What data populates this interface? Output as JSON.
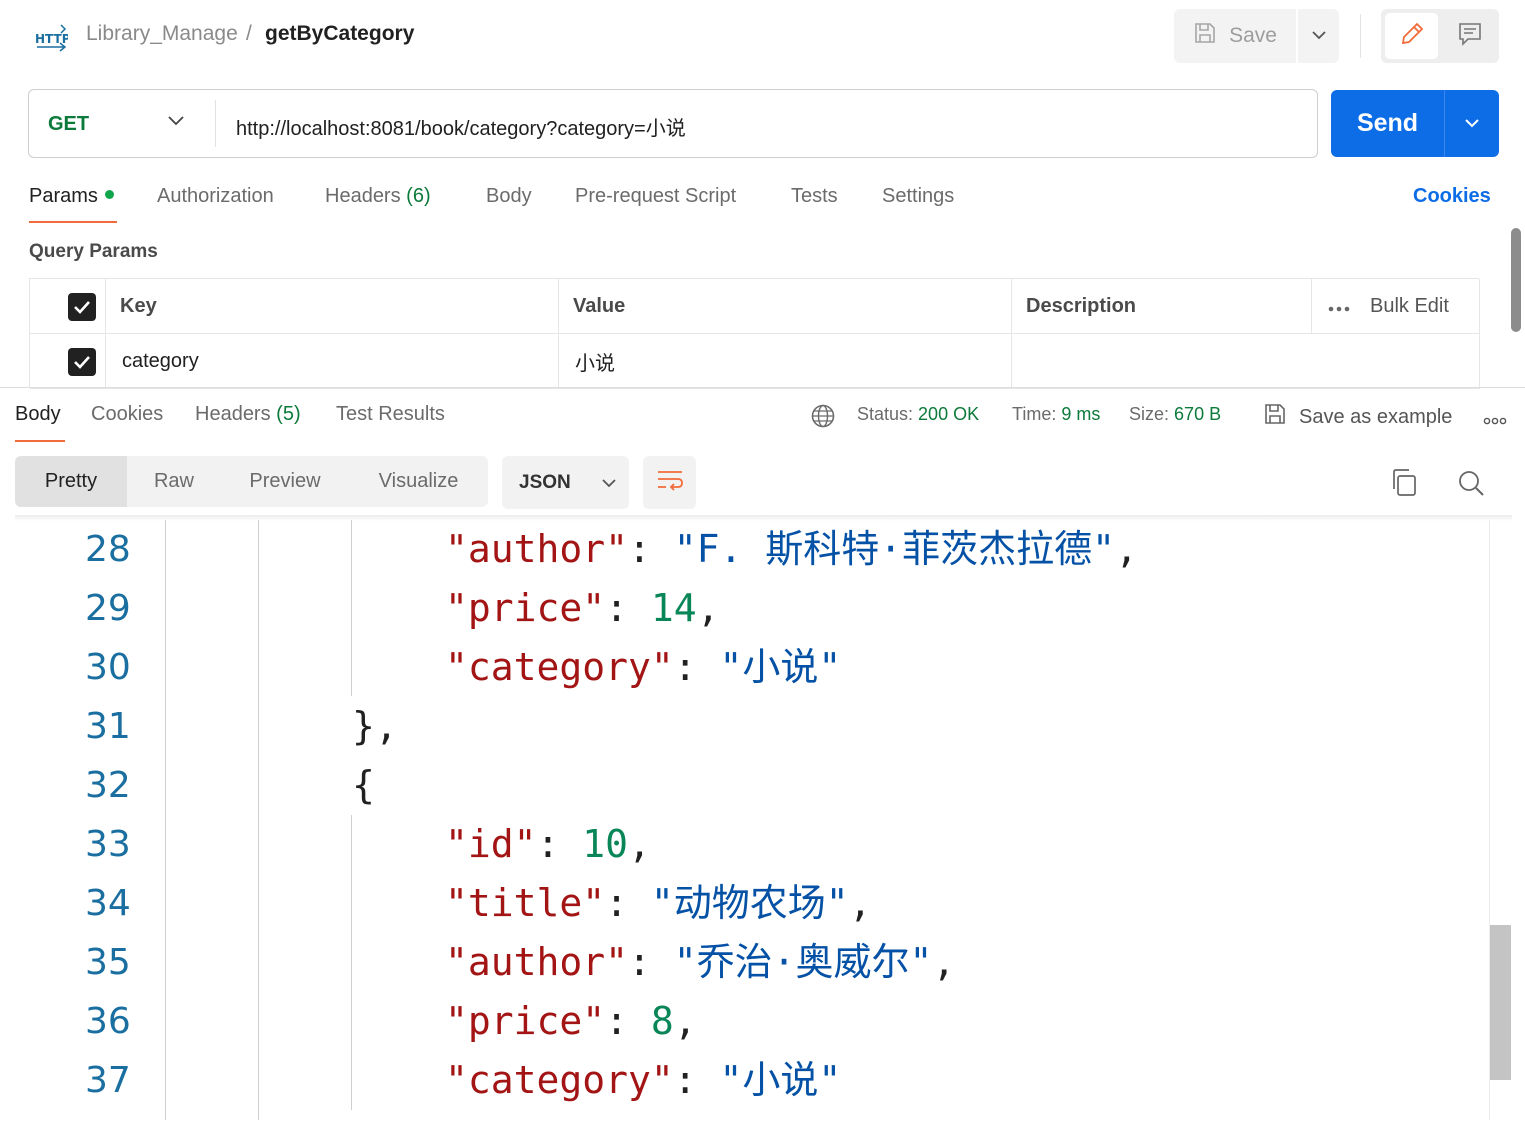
{
  "header": {
    "collection": "Library_Manage",
    "separator": "/",
    "request_name": "getByCategory",
    "save_label": "Save"
  },
  "request": {
    "method": "GET",
    "url": "http://localhost:8081/book/category?category=小说",
    "send_label": "Send"
  },
  "request_tabs": {
    "params": "Params",
    "authorization": "Authorization",
    "headers": "Headers",
    "headers_count": "(6)",
    "body": "Body",
    "pre_request": "Pre-request Script",
    "tests": "Tests",
    "settings": "Settings",
    "cookies": "Cookies"
  },
  "query_params": {
    "title": "Query Params",
    "columns": {
      "key": "Key",
      "value": "Value",
      "description": "Description",
      "bulk_edit": "Bulk Edit"
    },
    "rows": [
      {
        "key": "category",
        "value": "小说",
        "description": ""
      }
    ]
  },
  "response_tabs": {
    "body": "Body",
    "cookies": "Cookies",
    "headers": "Headers",
    "headers_count": "(5)",
    "test_results": "Test Results"
  },
  "response_meta": {
    "status_label": "Status:",
    "status_value": "200 OK",
    "time_label": "Time:",
    "time_value": "9 ms",
    "size_label": "Size:",
    "size_value": "670 B",
    "save_example": "Save as example"
  },
  "format_toolbar": {
    "pretty": "Pretty",
    "raw": "Raw",
    "preview": "Preview",
    "visualize": "Visualize",
    "language": "JSON"
  },
  "code_lines": [
    {
      "n": "28",
      "key": "\"author\"",
      "sep": ": ",
      "val": "\"F. 斯科特·菲茨杰拉德\"",
      "type": "s",
      "end": ","
    },
    {
      "n": "29",
      "key": "\"price\"",
      "sep": ": ",
      "val": "14",
      "type": "n",
      "end": ","
    },
    {
      "n": "30",
      "key": "\"category\"",
      "sep": ": ",
      "val": "\"小说\"",
      "type": "s",
      "end": ""
    },
    {
      "n": "31",
      "brace": "},",
      "type": "p"
    },
    {
      "n": "32",
      "brace": "{",
      "type": "p"
    },
    {
      "n": "33",
      "key": "\"id\"",
      "sep": ": ",
      "val": "10",
      "type": "n",
      "end": ","
    },
    {
      "n": "34",
      "key": "\"title\"",
      "sep": ": ",
      "val": "\"动物农场\"",
      "type": "s",
      "end": ","
    },
    {
      "n": "35",
      "key": "\"author\"",
      "sep": ": ",
      "val": "\"乔治·奥威尔\"",
      "type": "s",
      "end": ","
    },
    {
      "n": "36",
      "key": "\"price\"",
      "sep": ": ",
      "val": "8",
      "type": "n",
      "end": ","
    },
    {
      "n": "37",
      "key": "\"category\"",
      "sep": ": ",
      "val": "\"小说\"",
      "type": "s",
      "end": ""
    }
  ],
  "colors": {
    "accent_send": "#0d6de6",
    "method_get": "#0c7a3a",
    "tab_underline": "#f26b3a",
    "json_key": "#a31515",
    "json_string": "#0451a5",
    "json_number": "#098658"
  },
  "icons": [
    "http-icon",
    "save-icon",
    "chevron-down-icon",
    "pencil-icon",
    "comment-icon",
    "globe-icon",
    "ellipsis-icon",
    "wrap-lines-icon",
    "copy-icon",
    "search-icon",
    "checkbox-checked-icon"
  ]
}
